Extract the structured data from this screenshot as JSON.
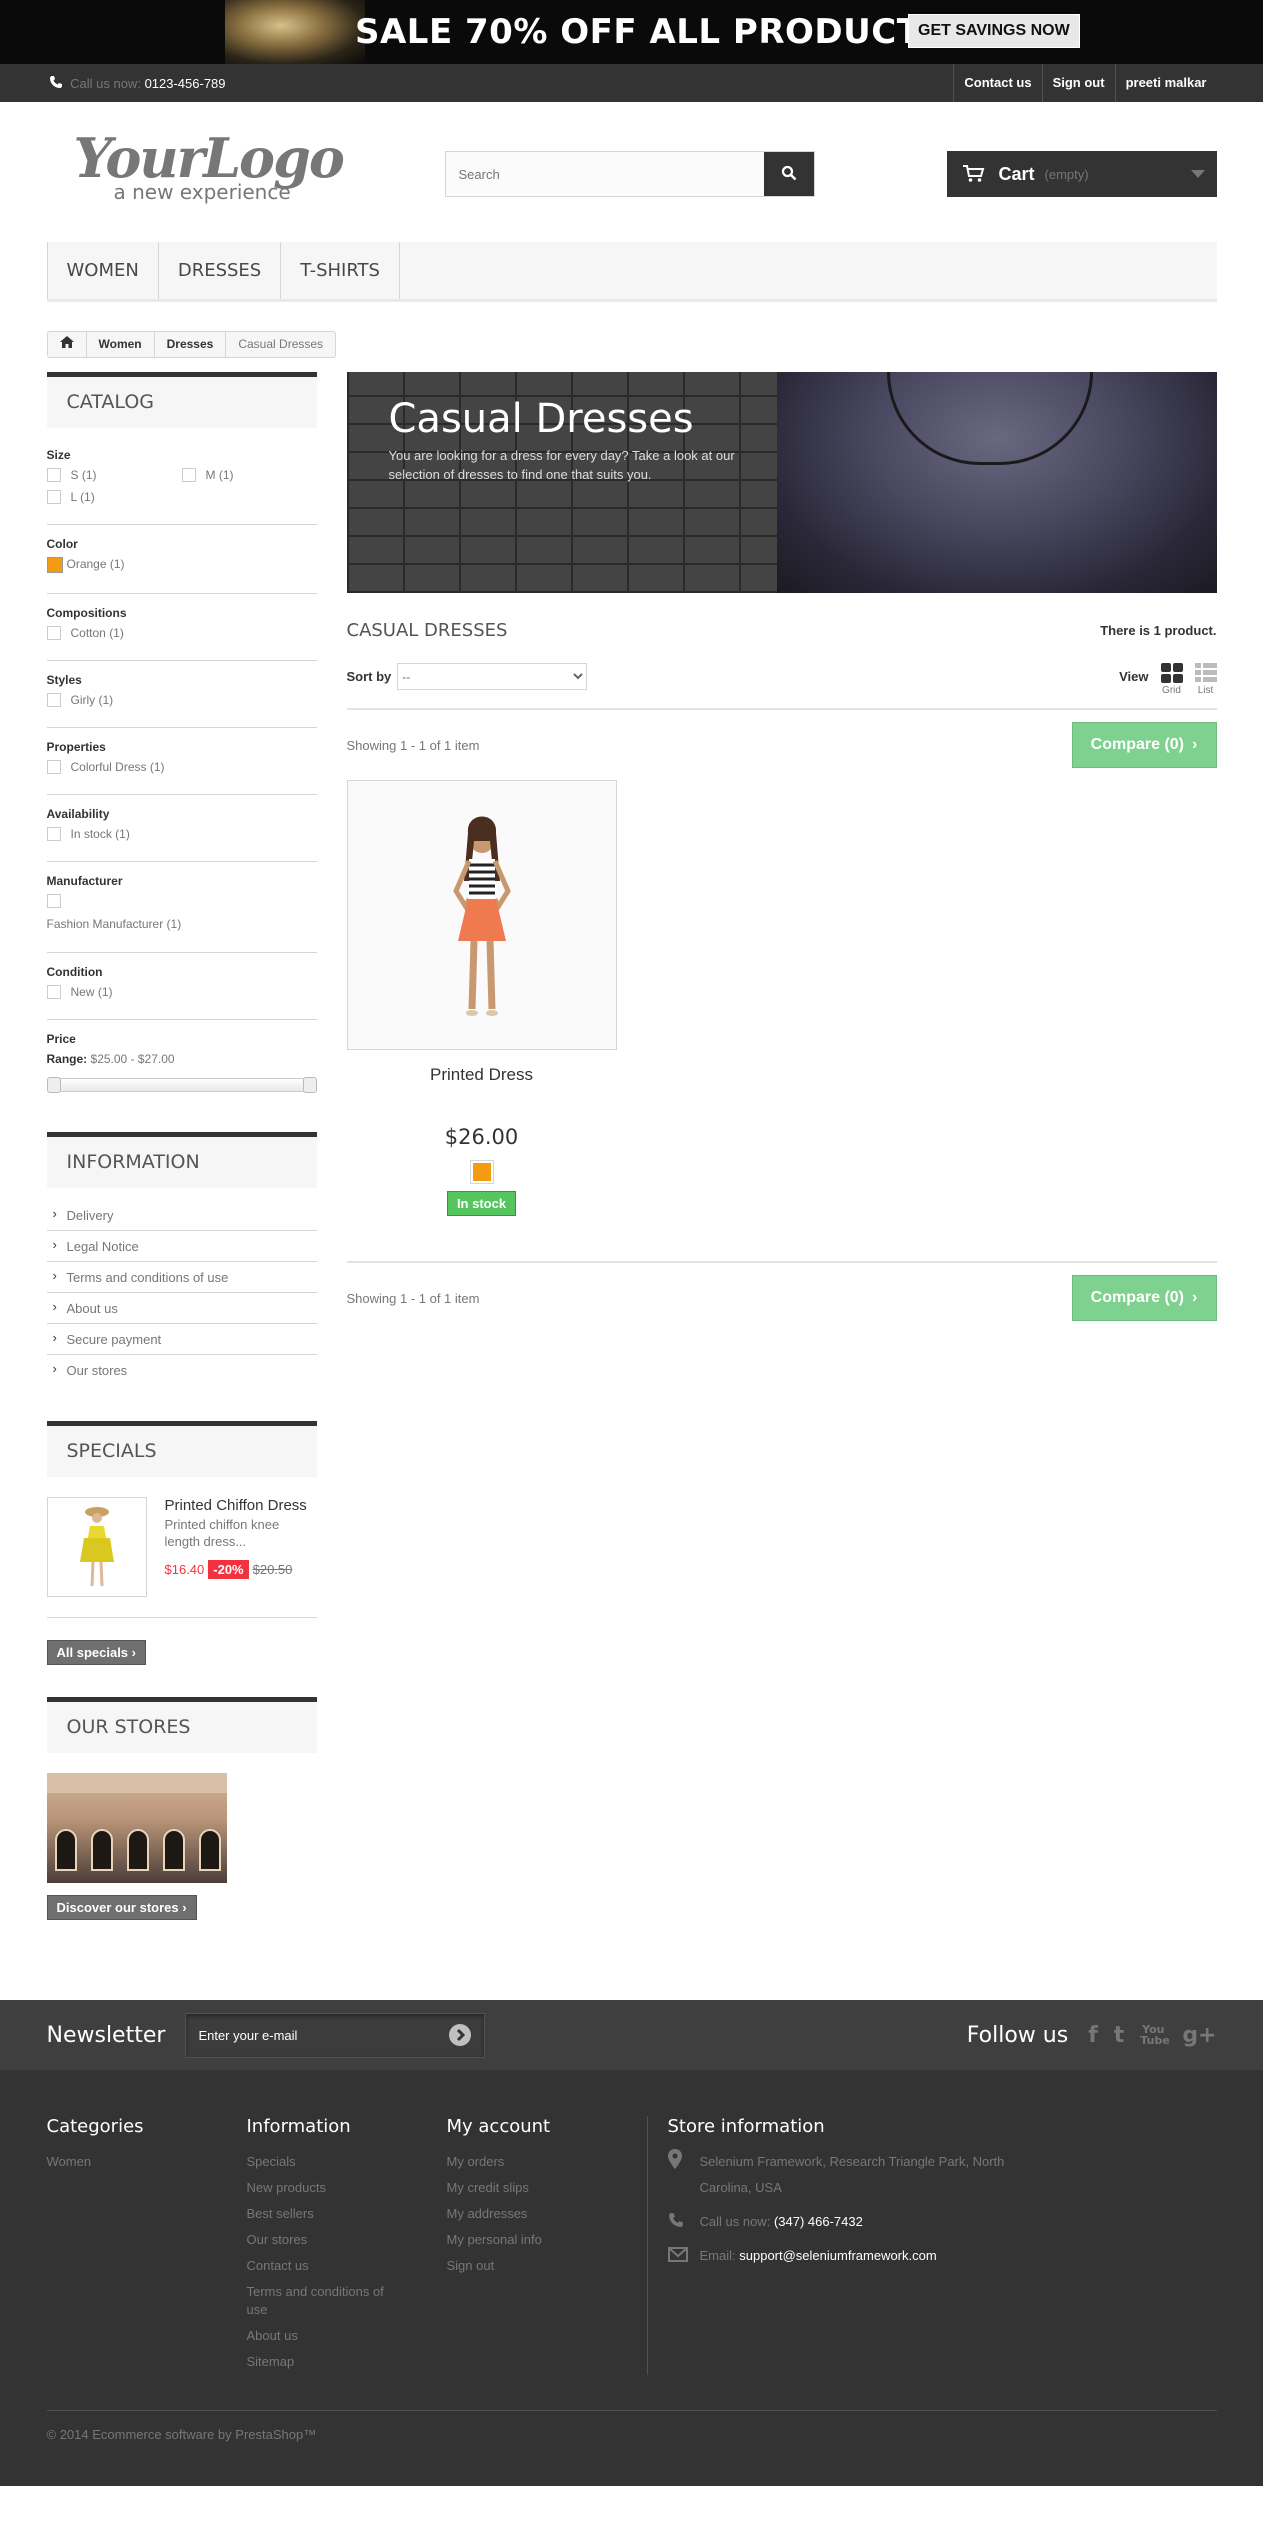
{
  "banner": {
    "sale_text": "SALE 70% OFF ALL PRODUCTS",
    "cta": "GET SAVINGS NOW"
  },
  "topnav": {
    "call_label": "Call us now:",
    "phone": "0123-456-789",
    "links": [
      "Contact us",
      "Sign out",
      "preeti malkar"
    ]
  },
  "header": {
    "logo_main": "YourLogo",
    "logo_tagline": "a new experience",
    "search_placeholder": "Search",
    "cart_label": "Cart",
    "cart_status": "(empty)"
  },
  "menu": [
    "WOMEN",
    "DRESSES",
    "T-SHIRTS"
  ],
  "breadcrumb": [
    "Women",
    "Dresses",
    "Casual Dresses"
  ],
  "catalog": {
    "title": "CATALOG",
    "filters": [
      {
        "title": "Size",
        "options": [
          "S (1)",
          "M (1)",
          "L (1)"
        ],
        "half": true
      },
      {
        "title": "Color",
        "options": [
          "Orange (1)"
        ],
        "swatch": "#f39c11"
      },
      {
        "title": "Compositions",
        "options": [
          "Cotton (1)"
        ]
      },
      {
        "title": "Styles",
        "options": [
          "Girly (1)"
        ]
      },
      {
        "title": "Properties",
        "options": [
          "Colorful Dress (1)"
        ]
      },
      {
        "title": "Availability",
        "options": [
          "In stock (1)"
        ]
      },
      {
        "title": "Manufacturer",
        "options": [
          "Fashion Manufacturer (1)"
        ]
      },
      {
        "title": "Condition",
        "options": [
          "New (1)"
        ]
      }
    ],
    "price": {
      "title": "Price",
      "range_label": "Range:",
      "range": "$25.00 - $27.00"
    }
  },
  "information": {
    "title": "INFORMATION",
    "items": [
      "Delivery",
      "Legal Notice",
      "Terms and conditions of use",
      "About us",
      "Secure payment",
      "Our stores"
    ]
  },
  "specials": {
    "title": "SPECIALS",
    "product_name": "Printed Chiffon Dress",
    "product_desc": "Printed chiffon knee length dress...",
    "new_price": "$16.40",
    "discount": "-20%",
    "old_price": "$20.50",
    "all_button": "All specials"
  },
  "stores": {
    "title": "OUR STORES",
    "button": "Discover our stores"
  },
  "category": {
    "banner_title": "Casual Dresses",
    "banner_desc": "You are looking for a dress for every day? Take a look at our selection of dresses to find one that suits you.",
    "heading": "CASUAL DRESSES",
    "count": "There is 1 product.",
    "sort_label": "Sort by",
    "sort_value": "--",
    "view_label": "View",
    "view_grid": "Grid",
    "view_list": "List",
    "showing": "Showing 1 - 1 of 1 item",
    "compare": "Compare (0)"
  },
  "product": {
    "name": "Printed Dress",
    "price": "$26.00",
    "color": "#f39c11",
    "stock": "In stock"
  },
  "footer": {
    "newsletter_title": "Newsletter",
    "newsletter_placeholder": "Enter your e-mail",
    "follow_title": "Follow us",
    "social": [
      "f",
      "t",
      "You Tube",
      "g+"
    ],
    "categories": {
      "title": "Categories",
      "items": [
        "Women"
      ]
    },
    "information": {
      "title": "Information",
      "items": [
        "Specials",
        "New products",
        "Best sellers",
        "Our stores",
        "Contact us",
        "Terms and conditions of use",
        "About us",
        "Sitemap"
      ]
    },
    "account": {
      "title": "My account",
      "items": [
        "My orders",
        "My credit slips",
        "My addresses",
        "My personal info",
        "Sign out"
      ]
    },
    "store": {
      "title": "Store information",
      "address": "Selenium Framework, Research Triangle Park, North Carolina, USA",
      "call_label": "Call us now:",
      "phone": "(347) 466-7432",
      "email_label": "Email:",
      "email": "support@seleniumframework.com"
    },
    "copyright": "© 2014 Ecommerce software by PrestaShop™"
  }
}
